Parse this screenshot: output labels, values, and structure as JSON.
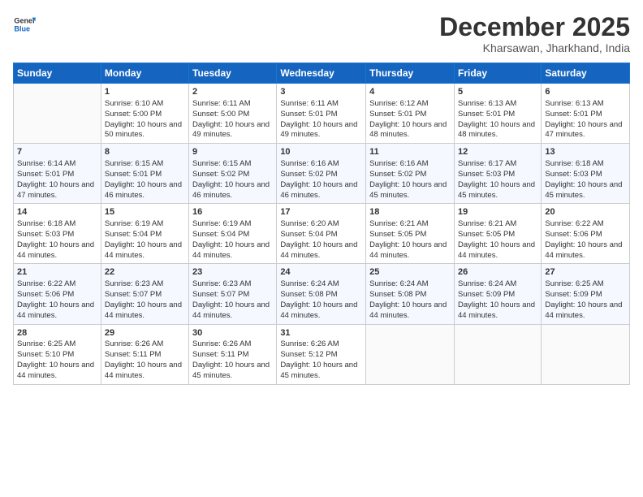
{
  "logo": {
    "text_general": "General",
    "text_blue": "Blue"
  },
  "title": "December 2025",
  "location": "Kharsawan, Jharkhand, India",
  "days_header": [
    "Sunday",
    "Monday",
    "Tuesday",
    "Wednesday",
    "Thursday",
    "Friday",
    "Saturday"
  ],
  "weeks": [
    [
      {
        "day": "",
        "sunrise": "",
        "sunset": "",
        "daylight": ""
      },
      {
        "day": "1",
        "sunrise": "Sunrise: 6:10 AM",
        "sunset": "Sunset: 5:00 PM",
        "daylight": "Daylight: 10 hours and 50 minutes."
      },
      {
        "day": "2",
        "sunrise": "Sunrise: 6:11 AM",
        "sunset": "Sunset: 5:00 PM",
        "daylight": "Daylight: 10 hours and 49 minutes."
      },
      {
        "day": "3",
        "sunrise": "Sunrise: 6:11 AM",
        "sunset": "Sunset: 5:01 PM",
        "daylight": "Daylight: 10 hours and 49 minutes."
      },
      {
        "day": "4",
        "sunrise": "Sunrise: 6:12 AM",
        "sunset": "Sunset: 5:01 PM",
        "daylight": "Daylight: 10 hours and 48 minutes."
      },
      {
        "day": "5",
        "sunrise": "Sunrise: 6:13 AM",
        "sunset": "Sunset: 5:01 PM",
        "daylight": "Daylight: 10 hours and 48 minutes."
      },
      {
        "day": "6",
        "sunrise": "Sunrise: 6:13 AM",
        "sunset": "Sunset: 5:01 PM",
        "daylight": "Daylight: 10 hours and 47 minutes."
      }
    ],
    [
      {
        "day": "7",
        "sunrise": "Sunrise: 6:14 AM",
        "sunset": "Sunset: 5:01 PM",
        "daylight": "Daylight: 10 hours and 47 minutes."
      },
      {
        "day": "8",
        "sunrise": "Sunrise: 6:15 AM",
        "sunset": "Sunset: 5:01 PM",
        "daylight": "Daylight: 10 hours and 46 minutes."
      },
      {
        "day": "9",
        "sunrise": "Sunrise: 6:15 AM",
        "sunset": "Sunset: 5:02 PM",
        "daylight": "Daylight: 10 hours and 46 minutes."
      },
      {
        "day": "10",
        "sunrise": "Sunrise: 6:16 AM",
        "sunset": "Sunset: 5:02 PM",
        "daylight": "Daylight: 10 hours and 46 minutes."
      },
      {
        "day": "11",
        "sunrise": "Sunrise: 6:16 AM",
        "sunset": "Sunset: 5:02 PM",
        "daylight": "Daylight: 10 hours and 45 minutes."
      },
      {
        "day": "12",
        "sunrise": "Sunrise: 6:17 AM",
        "sunset": "Sunset: 5:03 PM",
        "daylight": "Daylight: 10 hours and 45 minutes."
      },
      {
        "day": "13",
        "sunrise": "Sunrise: 6:18 AM",
        "sunset": "Sunset: 5:03 PM",
        "daylight": "Daylight: 10 hours and 45 minutes."
      }
    ],
    [
      {
        "day": "14",
        "sunrise": "Sunrise: 6:18 AM",
        "sunset": "Sunset: 5:03 PM",
        "daylight": "Daylight: 10 hours and 44 minutes."
      },
      {
        "day": "15",
        "sunrise": "Sunrise: 6:19 AM",
        "sunset": "Sunset: 5:04 PM",
        "daylight": "Daylight: 10 hours and 44 minutes."
      },
      {
        "day": "16",
        "sunrise": "Sunrise: 6:19 AM",
        "sunset": "Sunset: 5:04 PM",
        "daylight": "Daylight: 10 hours and 44 minutes."
      },
      {
        "day": "17",
        "sunrise": "Sunrise: 6:20 AM",
        "sunset": "Sunset: 5:04 PM",
        "daylight": "Daylight: 10 hours and 44 minutes."
      },
      {
        "day": "18",
        "sunrise": "Sunrise: 6:21 AM",
        "sunset": "Sunset: 5:05 PM",
        "daylight": "Daylight: 10 hours and 44 minutes."
      },
      {
        "day": "19",
        "sunrise": "Sunrise: 6:21 AM",
        "sunset": "Sunset: 5:05 PM",
        "daylight": "Daylight: 10 hours and 44 minutes."
      },
      {
        "day": "20",
        "sunrise": "Sunrise: 6:22 AM",
        "sunset": "Sunset: 5:06 PM",
        "daylight": "Daylight: 10 hours and 44 minutes."
      }
    ],
    [
      {
        "day": "21",
        "sunrise": "Sunrise: 6:22 AM",
        "sunset": "Sunset: 5:06 PM",
        "daylight": "Daylight: 10 hours and 44 minutes."
      },
      {
        "day": "22",
        "sunrise": "Sunrise: 6:23 AM",
        "sunset": "Sunset: 5:07 PM",
        "daylight": "Daylight: 10 hours and 44 minutes."
      },
      {
        "day": "23",
        "sunrise": "Sunrise: 6:23 AM",
        "sunset": "Sunset: 5:07 PM",
        "daylight": "Daylight: 10 hours and 44 minutes."
      },
      {
        "day": "24",
        "sunrise": "Sunrise: 6:24 AM",
        "sunset": "Sunset: 5:08 PM",
        "daylight": "Daylight: 10 hours and 44 minutes."
      },
      {
        "day": "25",
        "sunrise": "Sunrise: 6:24 AM",
        "sunset": "Sunset: 5:08 PM",
        "daylight": "Daylight: 10 hours and 44 minutes."
      },
      {
        "day": "26",
        "sunrise": "Sunrise: 6:24 AM",
        "sunset": "Sunset: 5:09 PM",
        "daylight": "Daylight: 10 hours and 44 minutes."
      },
      {
        "day": "27",
        "sunrise": "Sunrise: 6:25 AM",
        "sunset": "Sunset: 5:09 PM",
        "daylight": "Daylight: 10 hours and 44 minutes."
      }
    ],
    [
      {
        "day": "28",
        "sunrise": "Sunrise: 6:25 AM",
        "sunset": "Sunset: 5:10 PM",
        "daylight": "Daylight: 10 hours and 44 minutes."
      },
      {
        "day": "29",
        "sunrise": "Sunrise: 6:26 AM",
        "sunset": "Sunset: 5:11 PM",
        "daylight": "Daylight: 10 hours and 44 minutes."
      },
      {
        "day": "30",
        "sunrise": "Sunrise: 6:26 AM",
        "sunset": "Sunset: 5:11 PM",
        "daylight": "Daylight: 10 hours and 45 minutes."
      },
      {
        "day": "31",
        "sunrise": "Sunrise: 6:26 AM",
        "sunset": "Sunset: 5:12 PM",
        "daylight": "Daylight: 10 hours and 45 minutes."
      },
      {
        "day": "",
        "sunrise": "",
        "sunset": "",
        "daylight": ""
      },
      {
        "day": "",
        "sunrise": "",
        "sunset": "",
        "daylight": ""
      },
      {
        "day": "",
        "sunrise": "",
        "sunset": "",
        "daylight": ""
      }
    ]
  ]
}
